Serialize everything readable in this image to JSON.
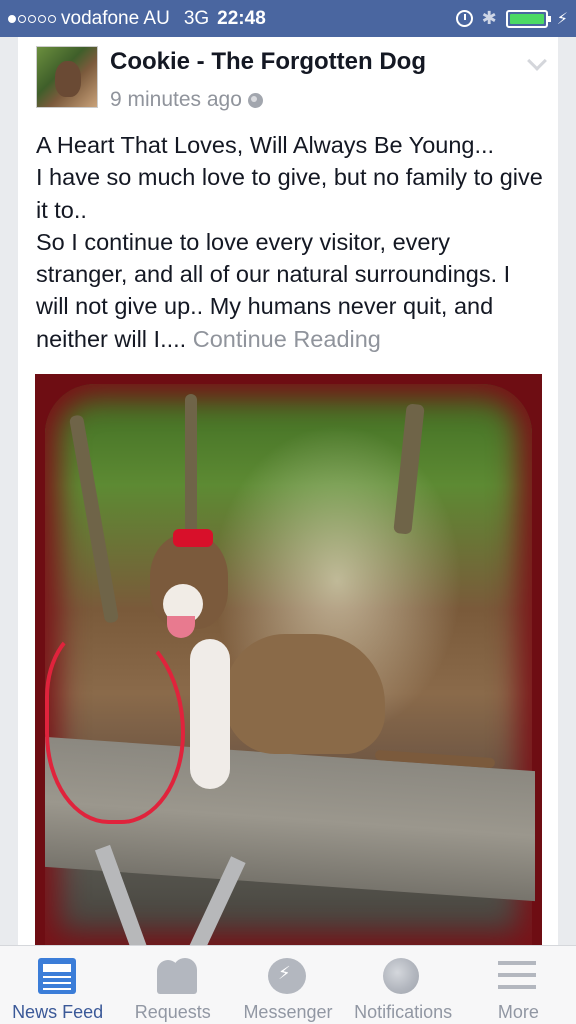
{
  "status_bar": {
    "carrier": "vodafone AU",
    "network": "3G",
    "time": "22:48",
    "signal_bars_filled": 1,
    "signal_bars_total": 5,
    "battery_color": "#4cd964"
  },
  "post": {
    "author": "Cookie - The Forgotten Dog",
    "timestamp": "9 minutes ago",
    "privacy_icon": "globe-icon",
    "text_lines": [
      "A Heart That Loves,  Will Always Be Young...",
      "I have so much love to give,  but no family to give it to..",
      "So I continue to love every visitor, every stranger, and all of our natural surroundings. I will not give up.. My humans never quit, and neither will I.... "
    ],
    "continue_label": "Continue Reading"
  },
  "tabs": [
    {
      "label": "News Feed",
      "icon": "newsfeed-icon",
      "active": true
    },
    {
      "label": "Requests",
      "icon": "requests-icon",
      "active": false
    },
    {
      "label": "Messenger",
      "icon": "messenger-icon",
      "active": false
    },
    {
      "label": "Notifications",
      "icon": "notifications-icon",
      "active": false
    },
    {
      "label": "More",
      "icon": "more-icon",
      "active": false
    }
  ],
  "colors": {
    "status_bar": "#4a66a0",
    "active_tab": "#3b5998",
    "photo_frame": "#6e0d13"
  }
}
